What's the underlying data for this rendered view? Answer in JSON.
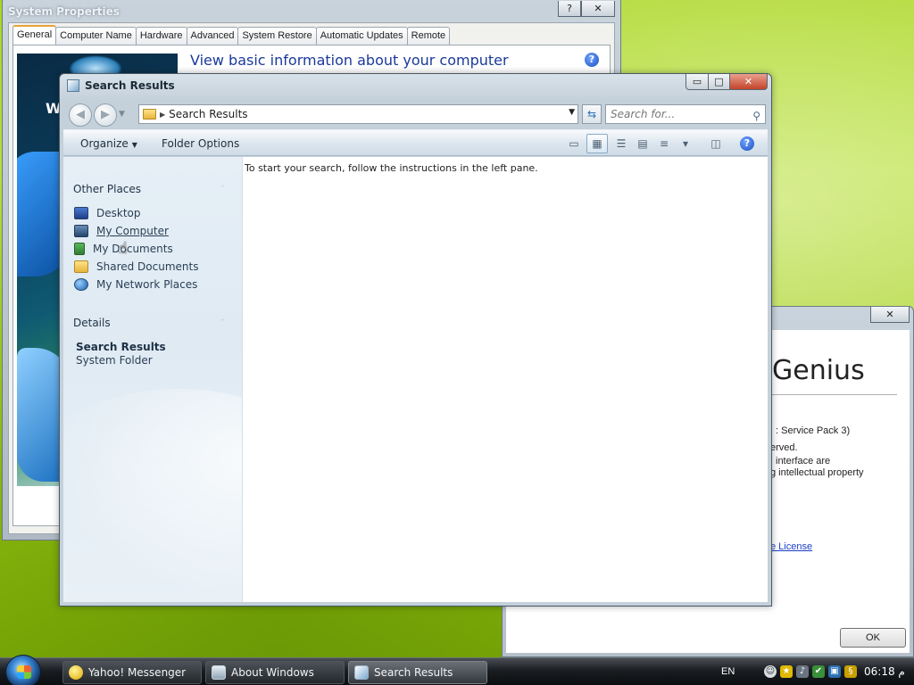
{
  "system_properties": {
    "title": "System Properties",
    "tabs": [
      "General",
      "Computer Name",
      "Hardware",
      "Advanced",
      "System Restore",
      "Automatic Updates",
      "Remote"
    ],
    "active_tab": "General",
    "heading": "View basic information about your computer",
    "art_letter": "W",
    "help_glyph": "?",
    "close_glyph": "✕"
  },
  "about_windows": {
    "heading": "Genius",
    "lines": [
      ": Service Pack 3)",
      "erved.",
      "interface are",
      "g intellectual property"
    ],
    "license_link": "e License",
    "ok_label": "OK",
    "close_glyph": "✕"
  },
  "search_window": {
    "title": "Search Results",
    "minimize_glyph": "▭",
    "maximize_glyph": "□",
    "close_glyph": "✕",
    "back_glyph": "◀",
    "forward_glyph": "▶",
    "address_path": "Search Results",
    "search_placeholder": "Search for...",
    "toolbar": {
      "organize_label": "Organize",
      "folder_options_label": "Folder Options"
    },
    "other_places": {
      "heading": "Other Places",
      "items": [
        {
          "label": "Desktop",
          "icon": "desktop-icon"
        },
        {
          "label": "My Computer",
          "icon": "computer-icon"
        },
        {
          "label": "My Documents",
          "icon": "documents-icon"
        },
        {
          "label": "Shared Documents",
          "icon": "shared-folder-icon"
        },
        {
          "label": "My Network Places",
          "icon": "network-icon"
        }
      ]
    },
    "details": {
      "heading": "Details",
      "name": "Search Results",
      "type": "System Folder"
    },
    "content_message": "To start your search, follow the instructions in the left pane."
  },
  "taskbar": {
    "buttons": [
      {
        "label": "Yahoo! Messenger",
        "icon": "yahoo-messenger-icon"
      },
      {
        "label": "About Windows",
        "icon": "about-windows-icon"
      },
      {
        "label": "Search Results",
        "icon": "search-results-icon"
      }
    ],
    "active_button": "Search Results",
    "language": "EN",
    "clock": "06:18 م"
  },
  "colors": {
    "wallpaper_green": "#a9d61f",
    "link_blue": "#1c3ec8",
    "title_text": "#1b2a36",
    "close_red": "#c3432a"
  }
}
